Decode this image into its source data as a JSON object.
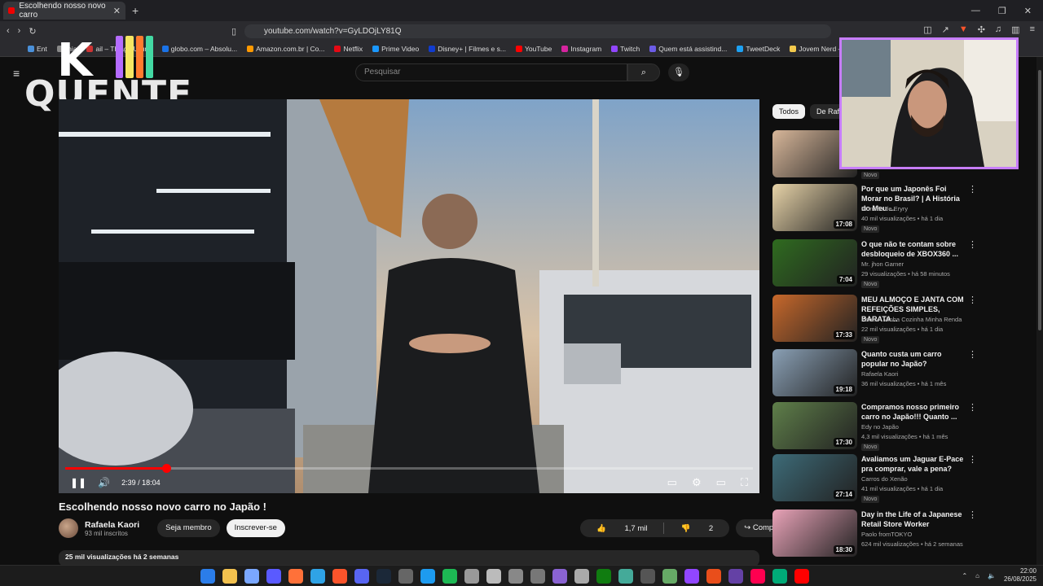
{
  "browser": {
    "tab_title": "Escolhendo nosso novo carro",
    "new_tab": "+",
    "url": "youtube.com/watch?v=GyLDOjLY81Q",
    "bookmarks": [
      "Ent",
      "thia",
      "ail – Thiago Urur...",
      "globo.com – Absolu...",
      "Amazon.com.br | Co...",
      "Netflix",
      "Prime Video",
      "Disney+ | Filmes e s...",
      "YouTube",
      "Instagram",
      "Twitch",
      "Quem está assistind...",
      "TweetDeck",
      "Jovem Nerd – Notíci..."
    ],
    "bookmark_colors": [
      "#4a90d9",
      "#888",
      "#c33",
      "#1a73e8",
      "#ff9900",
      "#e50914",
      "#1a98ff",
      "#113ccf",
      "#ff0000",
      "#d6249f",
      "#9146ff",
      "#6c5ce7",
      "#1da1f2",
      "#f2c94c"
    ]
  },
  "youtube": {
    "search_placeholder": "Pesquisar",
    "overlay_logo_k": "K",
    "overlay_logo_word": "QUENTE",
    "logo_bar_colors": [
      "#b56cff",
      "#f5e663",
      "#ff7b2e",
      "#43d9a3"
    ]
  },
  "player": {
    "time": "2:39 / 18:04",
    "progress_fraction": 0.147
  },
  "video": {
    "title": "Escolhendo nosso novo carro no Japão !",
    "channel": "Rafaela Kaori",
    "subscribers": "93 mil inscritos",
    "member_btn": "Seja membro",
    "subscribe_btn": "Inscrever-se",
    "likes": "1,7 mil",
    "dislikes": "2",
    "share": "Compartilhar",
    "description_preview": "25 mil visualizações  há 2 semanas"
  },
  "sidebar": {
    "chips": [
      "Todos",
      "De Rafa"
    ],
    "new_label": "Novo",
    "items": [
      {
        "title": "",
        "channel": "",
        "meta": "",
        "duration": "",
        "new": true,
        "thumb_color": "#d8b79a"
      },
      {
        "title": "Por que um Japonês Foi Morar no Brasil? | A História do Meu ...",
        "channel": "Mundão de Eryry",
        "meta": "40 mil visualizações • há 1 dia",
        "duration": "17:08",
        "new": true,
        "thumb_color": "#e7d3a8"
      },
      {
        "title": "O que não te contam sobre desbloqueio de XBOX360 ...",
        "channel": "Mr. jhon Garner",
        "meta": "29 visualizações • há 58 minutos",
        "duration": "7:04",
        "new": true,
        "thumb_color": "#2f6b1f"
      },
      {
        "title": "MEU ALMOÇO E JANTA COM REFEIÇÕES SIMPLES, BARATA...",
        "channel": "Karen - Minha Cozinha Minha Renda",
        "meta": "22 mil visualizações • há 1 dia",
        "duration": "17:33",
        "new": true,
        "thumb_color": "#c7682b"
      },
      {
        "title": "Quanto custa um carro popular no Japão?",
        "channel": "Rafaela Kaori",
        "meta": "36 mil visualizações • há 1 mês",
        "duration": "19:18",
        "new": false,
        "thumb_color": "#8aa0b5"
      },
      {
        "title": "Compramos nosso primeiro carro no Japão!!! Quanto ...",
        "channel": "Edy no Japão",
        "meta": "4,3 mil visualizações • há 1 mês",
        "duration": "17:30",
        "new": true,
        "thumb_color": "#5f7f4a"
      },
      {
        "title": "Avaliamos um Jaguar E-Pace pra comprar, vale a pena?",
        "channel": "Carros do Xenão",
        "meta": "41 mil visualizações • há 1 dia",
        "duration": "27:14",
        "new": true,
        "thumb_color": "#3d6b78"
      },
      {
        "title": "Day in the Life of a Japanese Retail Store Worker",
        "channel": "Paolo fromTOKYO",
        "meta": "624 mil visualizações • há 2 semanas",
        "duration": "18:30",
        "new": false,
        "thumb_color": "#e9a3b8"
      }
    ]
  },
  "taskbar": {
    "time": "22:00",
    "date": "26/08/2025",
    "icon_colors": [
      "#2b7de9",
      "#f2c14e",
      "#7aa7ff",
      "#5a5aff",
      "#ff7139",
      "#2fa3e6",
      "#fb542b",
      "#5865f2",
      "#1b2838",
      "#666",
      "#1d9bf0",
      "#1db954",
      "#999",
      "#bbb",
      "#888",
      "#777",
      "#8a63d2",
      "#aaa",
      "#107c10",
      "#4a9",
      "#555",
      "#6a6",
      "#9146ff",
      "#e94e1b",
      "#6441a5",
      "#ff0050",
      "#0a7",
      "#ff0000"
    ]
  }
}
